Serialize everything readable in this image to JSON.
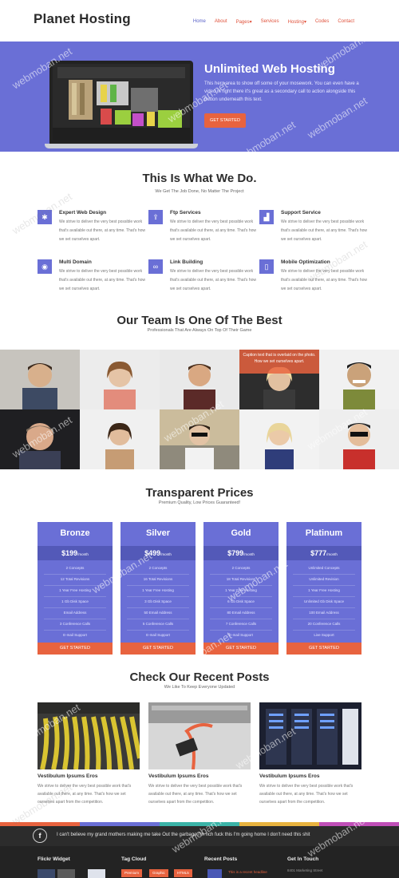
{
  "brand": {
    "logo": "Planet Hosting"
  },
  "nav": [
    "Home",
    "About",
    "Pages",
    "Services",
    "Hosting",
    "Codes",
    "Contact"
  ],
  "hero": {
    "title": "Unlimited Web Hosting",
    "text": "This hero area to show off some of your mosework. You can even have a video in right there it's great as a secondary call to action alongside this button underneath this text.",
    "button": "GET STARTED"
  },
  "services": {
    "title": "This Is What We Do.",
    "subtitle": "We Get The Job Done, No Matter The Project",
    "items": [
      {
        "title": "Expert Web Design",
        "text": "We strive to deliver the very best possible work that's available out there, at any time. That's how we set ourselves apart."
      },
      {
        "title": "Ftp Services",
        "text": "We strive to deliver the very best possible work that's available out there, at any time. That's how we set ourselves apart."
      },
      {
        "title": "Support Service",
        "text": "We strive to deliver the very best possible work that's available out there, at any time. That's how we set ourselves apart."
      },
      {
        "title": "Multi Domain",
        "text": "We strive to deliver the very best possible work that's available out there, at any time. That's how we set ourselves apart."
      },
      {
        "title": "Link Building",
        "text": "We strive to deliver the very best possible work that's available out there, at any time. That's how we set ourselves apart."
      },
      {
        "title": "Mobile Optimization",
        "text": "We strive to deliver the very best possible work that's available out there, at any time. That's how we set ourselves apart."
      }
    ]
  },
  "team": {
    "title": "Our Team Is One Of The Best",
    "subtitle": "Professionals That Are Always On Top Of Their Game",
    "overlay": "Caption text that is overlaid on the photo. How we set ourselves apart."
  },
  "pricing": {
    "title": "Transparent Prices",
    "subtitle": "Premium Quality, Low Prices Guaranteed!",
    "per": "/month",
    "button": "GET STARTED",
    "plans": [
      {
        "name": "Bronze",
        "price": "$199",
        "features": [
          "2 Concepts",
          "12 Total Revisions",
          "1 Year Free Hosting",
          "1 Gb Disk Space",
          "Email Address",
          "3 Conference Calls",
          "E-mail Support"
        ]
      },
      {
        "name": "Silver",
        "price": "$499",
        "features": [
          "2 Concepts",
          "16 Total Revisions",
          "1 Year Free Hosting",
          "3 Gb Disk Space",
          "50 Email Address",
          "5 Conference Calls",
          "E-mail Support"
        ]
      },
      {
        "name": "Gold",
        "price": "$799",
        "features": [
          "2 Concepts",
          "18 Total Revisions",
          "1 Year Free Hosting",
          "6 Gb Disk Space",
          "80 Email Address",
          "7 Conference Calls",
          "E-mail Support"
        ]
      },
      {
        "name": "Platinum",
        "price": "$777",
        "features": [
          "Unlimited Concepts",
          "Unlimited Revision",
          "1 Year Free Hosting",
          "Unlimited Gb Disk Space",
          "100 Email Address",
          "20 Conference Calls",
          "Live Support"
        ]
      }
    ]
  },
  "posts": {
    "title": "Check Our Recent Posts",
    "subtitle": "We Like To Keep Everyone Updated",
    "items": [
      {
        "title": "Vestibulum Ipsums Eros",
        "text": "We strive to deliver the very best possible work that's available out there, at any time. That's how we set ourselves apart from the competition."
      },
      {
        "title": "Vestibulum Ipsums Eros",
        "text": "We strive to deliver the very best possible work that's available out there, at any time. That's how we set ourselves apart from the competition."
      },
      {
        "title": "Vestibulum Ipsums Eros",
        "text": "We strive to deliver the very best possible work that's available out there, at any time. That's how we set ourselves apart from the competition."
      }
    ]
  },
  "footer": {
    "tweet": "I can't believe my grand mothers making me take Out the garbage I'm rich fuck this I'm going home I don't need this shit",
    "flickr": "Flickr Widget",
    "tags_title": "Tag Cloud",
    "tags": [
      "Premium",
      "Graphic",
      "HTML5"
    ],
    "recent_title": "Recent Posts",
    "recent_text": "This is a recent headline",
    "contact_title": "Get In Touch",
    "contact_text": "8401 Marketing Street"
  },
  "watermark": "webmoban.net",
  "colors": {
    "primary": "#6a6fd6",
    "accent": "#e8633f",
    "dark": "#232323"
  }
}
